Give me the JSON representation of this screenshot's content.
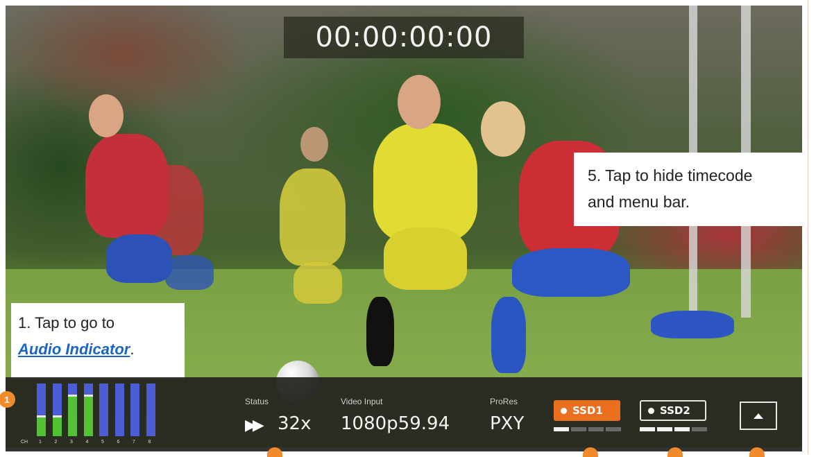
{
  "timecode": "00:00:00:00",
  "callouts": {
    "one": {
      "prefix": "1. Tap to go to",
      "link": "Audio Indicator",
      "suffix": "."
    },
    "five": {
      "line1": "5. Tap to hide timecode",
      "line2": "and menu bar."
    }
  },
  "badges": {
    "one": "1"
  },
  "audio_meter": {
    "ch_label": "CH",
    "channels": [
      {
        "label": "1",
        "level": 0.35
      },
      {
        "label": "2",
        "level": 0.35
      },
      {
        "label": "3",
        "level": 0.75
      },
      {
        "label": "4",
        "level": 0.75
      },
      {
        "label": "5",
        "level": 0
      },
      {
        "label": "6",
        "level": 0
      },
      {
        "label": "7",
        "level": 0
      },
      {
        "label": "8",
        "level": 0
      }
    ]
  },
  "status": {
    "label": "Status",
    "value": "32x",
    "icon": "fast-forward-icon"
  },
  "video_input": {
    "label": "Video Input",
    "value": "1080p59.94"
  },
  "prores": {
    "label": "ProRes",
    "value": "PXY"
  },
  "ssd1": {
    "label": "SSD1",
    "active": true,
    "segments_filled": 1,
    "segments_total": 4
  },
  "ssd2": {
    "label": "SSD2",
    "active": false,
    "segments_filled": 3,
    "segments_total": 4
  },
  "colors": {
    "accent": "#ea6f1e",
    "meter_bar": "#4c5ed6",
    "meter_level": "#52c234",
    "bar_bg": "#22221e"
  }
}
